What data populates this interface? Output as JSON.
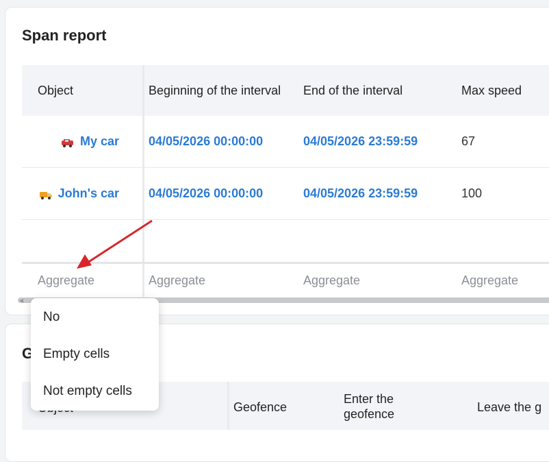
{
  "report": {
    "title": "Span report",
    "columns": [
      "Object",
      "Beginning of the interval",
      "End of the interval",
      "Max speed"
    ],
    "rows": [
      {
        "icon": "red-car-icon",
        "object": "My car",
        "begin": "04/05/2026 00:00:00",
        "end": "04/05/2026 23:59:59",
        "max_speed": "67"
      },
      {
        "icon": "orange-truck-icon",
        "object": "John's car",
        "begin": "04/05/2026 00:00:00",
        "end": "04/05/2026 23:59:59",
        "max_speed": "100"
      }
    ],
    "aggregate_placeholder": "Aggregate"
  },
  "dropdown": {
    "options": [
      "No",
      "Empty cells",
      "Not empty cells"
    ]
  },
  "second_report": {
    "title_visible": "G",
    "columns": [
      "Object",
      "Geofence",
      "Enter the geofence",
      "Leave the g"
    ]
  },
  "colors": {
    "link": "#2a7bd4",
    "annotation_arrow": "#d8262b"
  }
}
